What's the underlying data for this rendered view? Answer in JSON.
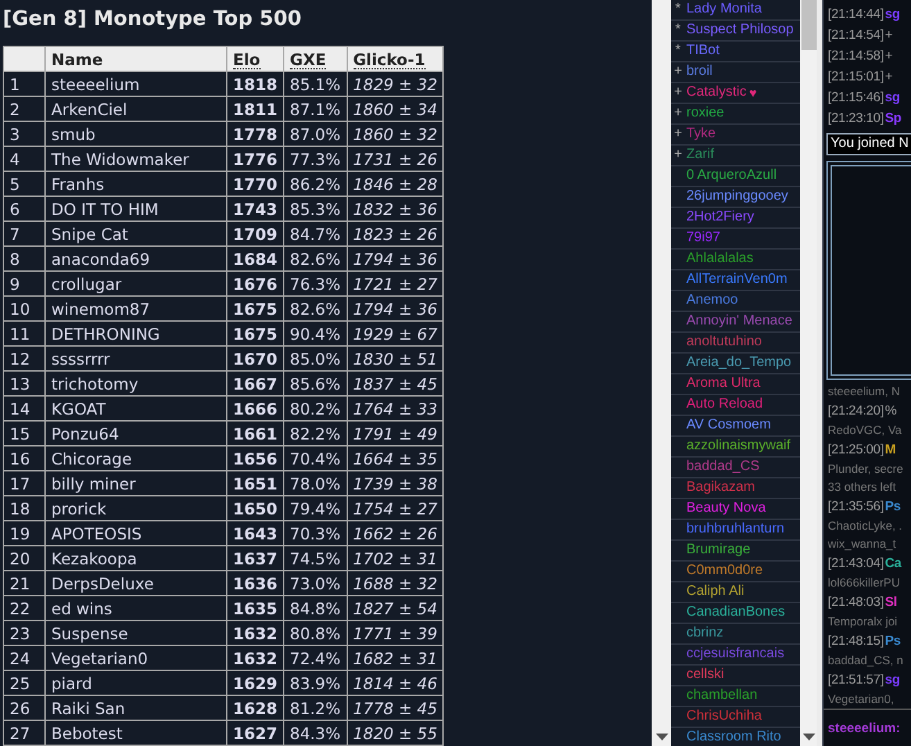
{
  "ladder": {
    "title": "[Gen 8] Monotype Top 500",
    "columns": [
      {
        "label": "Name",
        "sortable": false
      },
      {
        "label": "Elo",
        "sortable": true
      },
      {
        "label": "GXE",
        "sortable": true
      },
      {
        "label": "Glicko-1",
        "sortable": true
      }
    ],
    "rows": [
      {
        "rank": "1",
        "name": "steeeelium",
        "elo": "1818",
        "gxe": "85.1%",
        "glicko": "1829 ± 32"
      },
      {
        "rank": "2",
        "name": "ArkenCiel",
        "elo": "1811",
        "gxe": "87.1%",
        "glicko": "1860 ± 34"
      },
      {
        "rank": "3",
        "name": "smub",
        "elo": "1778",
        "gxe": "87.0%",
        "glicko": "1860 ± 32"
      },
      {
        "rank": "4",
        "name": "The Widowmaker",
        "elo": "1776",
        "gxe": "77.3%",
        "glicko": "1731 ± 26"
      },
      {
        "rank": "5",
        "name": "Franhs",
        "elo": "1770",
        "gxe": "86.2%",
        "glicko": "1846 ± 28"
      },
      {
        "rank": "6",
        "name": "DO IT TO HIM",
        "elo": "1743",
        "gxe": "85.3%",
        "glicko": "1832 ± 36"
      },
      {
        "rank": "7",
        "name": "Snipe Cat",
        "elo": "1709",
        "gxe": "84.7%",
        "glicko": "1823 ± 26"
      },
      {
        "rank": "8",
        "name": "anaconda69",
        "elo": "1684",
        "gxe": "82.6%",
        "glicko": "1794 ± 36"
      },
      {
        "rank": "9",
        "name": "crollugar",
        "elo": "1676",
        "gxe": "76.3%",
        "glicko": "1721 ± 27"
      },
      {
        "rank": "10",
        "name": "winemom87",
        "elo": "1675",
        "gxe": "82.6%",
        "glicko": "1794 ± 36"
      },
      {
        "rank": "11",
        "name": "DETHRONING",
        "elo": "1675",
        "gxe": "90.4%",
        "glicko": "1929 ± 67"
      },
      {
        "rank": "12",
        "name": "ssssrrrr",
        "elo": "1670",
        "gxe": "85.0%",
        "glicko": "1830 ± 51"
      },
      {
        "rank": "13",
        "name": "trichotomy",
        "elo": "1667",
        "gxe": "85.6%",
        "glicko": "1837 ± 45"
      },
      {
        "rank": "14",
        "name": "KGOAT",
        "elo": "1666",
        "gxe": "80.2%",
        "glicko": "1764 ± 33"
      },
      {
        "rank": "15",
        "name": "Ponzu64",
        "elo": "1661",
        "gxe": "82.2%",
        "glicko": "1791 ± 49"
      },
      {
        "rank": "16",
        "name": "Chicorage",
        "elo": "1656",
        "gxe": "70.4%",
        "glicko": "1664 ± 35"
      },
      {
        "rank": "17",
        "name": "billy miner",
        "elo": "1651",
        "gxe": "78.0%",
        "glicko": "1739 ± 38"
      },
      {
        "rank": "18",
        "name": "prorick",
        "elo": "1650",
        "gxe": "79.4%",
        "glicko": "1754 ± 27"
      },
      {
        "rank": "19",
        "name": "APOTEOSIS",
        "elo": "1643",
        "gxe": "70.3%",
        "glicko": "1662 ± 26"
      },
      {
        "rank": "20",
        "name": "Kezakoopa",
        "elo": "1637",
        "gxe": "74.5%",
        "glicko": "1702 ± 31"
      },
      {
        "rank": "21",
        "name": "DerpsDeluxe",
        "elo": "1636",
        "gxe": "73.0%",
        "glicko": "1688 ± 32"
      },
      {
        "rank": "22",
        "name": "ed wins",
        "elo": "1635",
        "gxe": "84.8%",
        "glicko": "1827 ± 54"
      },
      {
        "rank": "23",
        "name": "Suspense",
        "elo": "1632",
        "gxe": "80.8%",
        "glicko": "1771 ± 39"
      },
      {
        "rank": "24",
        "name": "Vegetarian0",
        "elo": "1632",
        "gxe": "72.4%",
        "glicko": "1682 ± 31"
      },
      {
        "rank": "25",
        "name": "piard",
        "elo": "1629",
        "gxe": "83.9%",
        "glicko": "1814 ± 46"
      },
      {
        "rank": "26",
        "name": "Raiki San",
        "elo": "1628",
        "gxe": "81.2%",
        "glicko": "1778 ± 45"
      },
      {
        "rank": "27",
        "name": "Bebotest",
        "elo": "1627",
        "gxe": "84.3%",
        "glicko": "1820 ± 55"
      }
    ]
  },
  "users": [
    {
      "rank": "*",
      "name": "Lady Monita",
      "color": "#6b5cff"
    },
    {
      "rank": "*",
      "name": "Suspect Philosop",
      "color": "#7a5cff"
    },
    {
      "rank": "*",
      "name": "TIBot",
      "color": "#6a6aff"
    },
    {
      "rank": "+",
      "name": "broil",
      "color": "#5a7ae0"
    },
    {
      "rank": "+",
      "name": "Catalystic",
      "badge": "♥",
      "color": "#e0287a"
    },
    {
      "rank": "+",
      "name": "roxiee",
      "color": "#22aa44"
    },
    {
      "rank": "+",
      "name": "Tyke",
      "color": "#b02a80"
    },
    {
      "rank": "+",
      "name": "Zarif",
      "color": "#2a8a5a"
    },
    {
      "name": "0 ArqueroAzull",
      "color": "#2aaa44"
    },
    {
      "name": "26jumpinggooey",
      "color": "#6a8aff"
    },
    {
      "name": "2Hot2Fiery",
      "color": "#8a4aff"
    },
    {
      "name": "79i97",
      "color": "#9a2aff"
    },
    {
      "name": "Ahlalalalas",
      "color": "#2aa02a"
    },
    {
      "name": "AllTerrainVen0m",
      "color": "#3a7aff"
    },
    {
      "name": "Anemoo",
      "color": "#4a7ae0"
    },
    {
      "name": "Annoyin' Menace",
      "color": "#9a4ab0"
    },
    {
      "name": "anoltutuhino",
      "color": "#c03a5a"
    },
    {
      "name": "Areia_do_Tempo",
      "color": "#4a9ab0"
    },
    {
      "name": "Aroma Ultra",
      "color": "#e02a6a"
    },
    {
      "name": "Auto Reload",
      "color": "#e0207a"
    },
    {
      "name": "AV Cosmoem",
      "color": "#6a8aff"
    },
    {
      "name": "azzolinaismywaif",
      "color": "#5ab02a"
    },
    {
      "name": "baddad_CS",
      "color": "#b03a8a"
    },
    {
      "name": "Bagikazam",
      "color": "#d0304a"
    },
    {
      "name": "Beauty Nova",
      "color": "#e020e0"
    },
    {
      "name": "bruhbruhlanturn",
      "color": "#4a6aff"
    },
    {
      "name": "Brumirage",
      "color": "#3ab03a"
    },
    {
      "name": "C0mm0d0re",
      "color": "#c07a2a"
    },
    {
      "name": "Caliph Ali",
      "color": "#b0a030"
    },
    {
      "name": "CanadianBones",
      "color": "#2ab09a"
    },
    {
      "name": "cbrinz",
      "color": "#3a9aa0"
    },
    {
      "name": "ccjesuisfrancais",
      "color": "#7a4ae0"
    },
    {
      "name": "cellski",
      "color": "#e03a5a"
    },
    {
      "name": "chambellan",
      "color": "#2aa02a"
    },
    {
      "name": "ChrisUchiha",
      "color": "#d0303a"
    },
    {
      "name": "Classroom Rito",
      "color": "#3a8ad0"
    }
  ],
  "chat": {
    "messages": [
      {
        "time": "[21:14:44]",
        "user": "sg",
        "color": "#7b3dff"
      },
      {
        "time": "[21:14:54]",
        "rank": "+"
      },
      {
        "time": "[21:14:58]",
        "rank": "+"
      },
      {
        "time": "[21:15:01]",
        "rank": "+"
      },
      {
        "time": "[21:15:46]",
        "user": "sg",
        "color": "#7b3dff"
      },
      {
        "time": "[21:23:10]",
        "user": "Sp",
        "color": "#8a3aff"
      }
    ],
    "joined_notice": "You joined N",
    "log": [
      {
        "kind": "notice",
        "text": "steeeelium, N"
      },
      {
        "kind": "message",
        "time": "[21:24:20]",
        "rank": "%"
      },
      {
        "kind": "notice",
        "text": "RedoVGC, Va"
      },
      {
        "kind": "message",
        "time": "[21:25:00]",
        "user": "M",
        "color": "#c8a020"
      },
      {
        "kind": "notice",
        "text": "Plunder, secre"
      },
      {
        "kind": "notice",
        "text": "33 others left"
      },
      {
        "kind": "message",
        "time": "[21:35:56]",
        "user": "Ps",
        "color": "#3a8ad0"
      },
      {
        "kind": "notice",
        "text": "ChaoticLyke, ."
      },
      {
        "kind": "notice",
        "text": "wix_wanna_t"
      },
      {
        "kind": "message",
        "time": "[21:43:04]",
        "user": "Ca",
        "color": "#2ab09a"
      },
      {
        "kind": "notice",
        "text": "lol666killerPU"
      },
      {
        "kind": "message",
        "time": "[21:48:03]",
        "user": "Sl",
        "color": "#e030c0"
      },
      {
        "kind": "notice",
        "text": "Temporalx joi"
      },
      {
        "kind": "message",
        "time": "[21:48:15]",
        "user": "Ps",
        "color": "#3a8ad0"
      },
      {
        "kind": "notice",
        "text": "baddad_CS, n"
      },
      {
        "kind": "message",
        "time": "[21:51:57]",
        "user": "sg",
        "color": "#7b3dff"
      },
      {
        "kind": "notice",
        "text": "Vegetarian0,"
      }
    ],
    "input_label": "steeeelium:"
  }
}
